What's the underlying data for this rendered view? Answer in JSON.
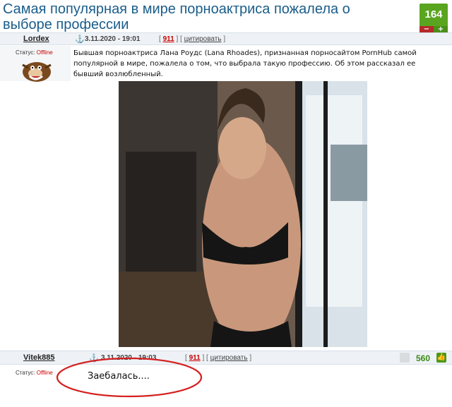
{
  "topic": {
    "title": "Самая популярная в мире порноактриса пожалела о выборе профессии",
    "rating": "164",
    "minus": "−",
    "plus": "+"
  },
  "post1": {
    "author": "Lordex",
    "date": "3.11.2020 - 19:01",
    "num": "911",
    "cite": "цитировать",
    "status_label": "Статус:",
    "status_value": "Offline",
    "text": "Бывшая порноактриса Лана Роудс (Lana Rhoades), признанная порносайтом PornHub самой популярной в мире, пожалела о том, что выбрала такую профессию. Об этом рассказал ее бывший возлюбленный."
  },
  "post2": {
    "author": "Vitek885",
    "date": "3.11.2020 - 19:03",
    "num": "911",
    "cite": "цитировать",
    "rating": "560",
    "status_label": "Статус:",
    "status_value": "Offline",
    "text": "Заебалась...."
  },
  "colors": {
    "title": "#1a5d8a",
    "rating_green": "#5aa51f",
    "offline_red": "#cc0000",
    "ellipse_red": "#d42020"
  }
}
